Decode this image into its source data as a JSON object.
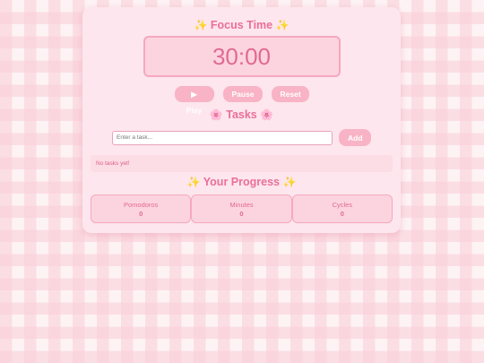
{
  "timer": {
    "title": "Focus Time",
    "display": "30:00",
    "controls": {
      "play_label": "▶ Play",
      "pause_label": "Pause",
      "reset_label": "Reset"
    }
  },
  "tasks": {
    "title": "Tasks",
    "input_placeholder": "Enter a task...",
    "add_label": "Add",
    "empty_text": "No tasks yet!"
  },
  "progress": {
    "title": "Your Progress",
    "stats": [
      {
        "label": "Pomodoros",
        "value": "0"
      },
      {
        "label": "Minutes",
        "value": "0"
      },
      {
        "label": "Cycles",
        "value": "0"
      }
    ]
  },
  "icons": {
    "sparkle": "✨",
    "flower": "🌸"
  },
  "colors": {
    "accent": "#ea6f9a",
    "button": "#f9b3c6",
    "card": "#fde6ed",
    "border": "#f5a8bf"
  }
}
